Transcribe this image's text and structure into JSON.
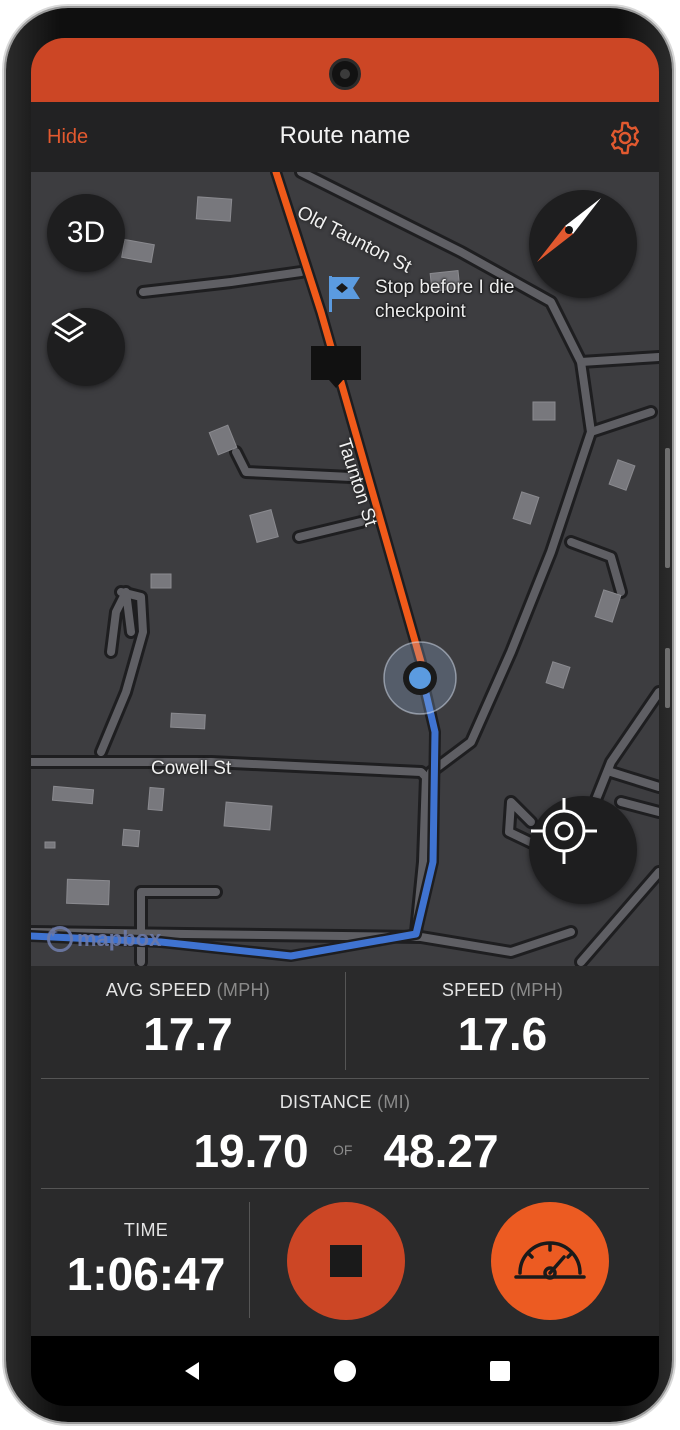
{
  "header": {
    "hide_label": "Hide",
    "title": "Route name",
    "settings_icon": "gear-icon"
  },
  "map": {
    "btn_3d_label": "3D",
    "layers_icon": "layers-icon",
    "compass_icon": "compass-icon",
    "locate_icon": "crosshair-icon",
    "checkpoint_label_line1": "Stop before I die",
    "checkpoint_label_line2": "checkpoint",
    "streets": {
      "old_taunton": "Old Taunton St",
      "taunton": "Taunton St",
      "cowell": "Cowell St"
    },
    "attribution": "mapbox",
    "colors": {
      "route_ahead": "#f05a1a",
      "route_done": "#3f73d1",
      "location_dot": "#5b9be0"
    }
  },
  "stats": {
    "avg_speed": {
      "label": "AVG SPEED",
      "unit": "(MPH)",
      "value": "17.7"
    },
    "speed": {
      "label": "SPEED",
      "unit": "(MPH)",
      "value": "17.6"
    },
    "distance": {
      "label": "DISTANCE",
      "unit": "(MI)",
      "value": "19.70",
      "of_label": "OF",
      "total": "48.27"
    },
    "time": {
      "label": "TIME",
      "value": "1:06:47"
    }
  },
  "controls": {
    "stop_icon": "stop-icon",
    "speedometer_icon": "speedometer-icon"
  },
  "system_nav": {
    "back_icon": "back-icon",
    "home_icon": "home-icon",
    "recents_icon": "recents-icon"
  },
  "theme": {
    "accent": "#cc4625",
    "accent_bright": "#ec5b22",
    "panel": "#2a2a2b",
    "bar": "#222223"
  }
}
